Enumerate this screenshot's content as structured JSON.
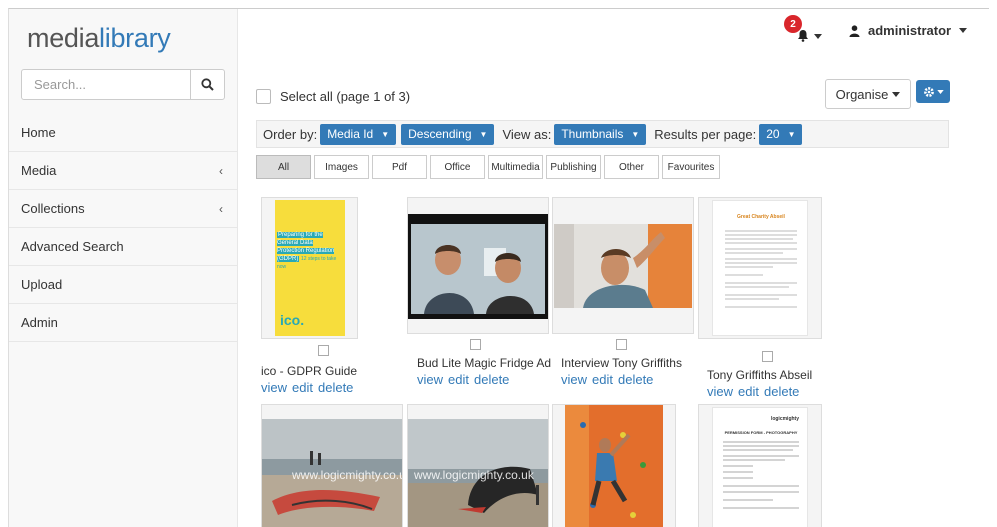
{
  "brand": {
    "part1": "media",
    "part2": "library"
  },
  "search": {
    "placeholder": "Search..."
  },
  "nav": [
    {
      "label": "Home",
      "chevron": ""
    },
    {
      "label": "Media",
      "chevron": "‹"
    },
    {
      "label": "Collections",
      "chevron": "‹"
    },
    {
      "label": "Advanced Search",
      "chevron": ""
    },
    {
      "label": "Upload",
      "chevron": ""
    },
    {
      "label": "Admin",
      "chevron": ""
    }
  ],
  "notifications": {
    "count": "2"
  },
  "user": {
    "name": "administrator"
  },
  "toolbar": {
    "select_all": "Select all (page 1 of 3)",
    "organise": "Organise",
    "order_by_label": "Order by:",
    "order_by_value": "Media Id",
    "order_dir_value": "Descending",
    "view_as_label": "View as:",
    "view_as_value": "Thumbnails",
    "per_page_label": "Results per page:",
    "per_page_value": "20"
  },
  "tabs": [
    "All",
    "Images",
    "Pdf",
    "Office",
    "Multimedia",
    "Publishing",
    "Other",
    "Favourites"
  ],
  "active_tab": "All",
  "items": [
    {
      "title": "ico - GDPR Guide",
      "view": "view",
      "edit": "edit",
      "delete": "delete",
      "thumb_text": "Preparing for the General Data Protection Regulation (GDPR)",
      "thumb_sub": "12 steps to take now",
      "logo": "ico."
    },
    {
      "title": "Bud Lite Magic Fridge Ad",
      "view": "view",
      "edit": "edit",
      "delete": "delete"
    },
    {
      "title": "Interview Tony Griffiths",
      "view": "view",
      "edit": "edit",
      "delete": "delete"
    },
    {
      "title": "Tony Griffiths Abseil",
      "view": "view",
      "edit": "edit",
      "delete": "delete",
      "doc_heading": "Great Charity Abseil"
    },
    {
      "watermark": "www.logicmighty.co.uk"
    },
    {
      "watermark": "www.logicmighty.co.uk"
    },
    {},
    {
      "doc_brand": "logicmighty",
      "doc_heading": "PERMISSION FORM - PHOTOGRAPHY"
    }
  ],
  "colors": {
    "accent": "#337ab7",
    "badge": "#d9262b",
    "ico_yellow": "#f7dd3c",
    "ico_teal": "#2aa9b5"
  }
}
